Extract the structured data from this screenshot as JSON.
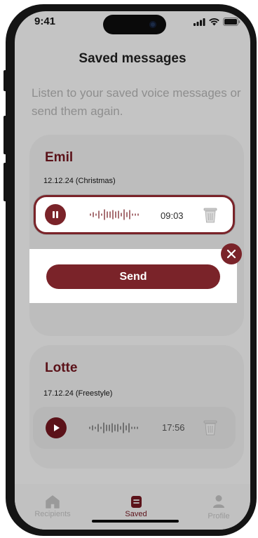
{
  "status_bar": {
    "time": "9:41"
  },
  "header": {
    "title": "Saved messages"
  },
  "intro_text": "Listen to your saved voice messages or send them again.",
  "messages": [
    {
      "name": "Emil",
      "date": "12.12.24 (Christmas)",
      "duration": "09:03",
      "state": "playing"
    },
    {
      "name": "Lotte",
      "date": "17.12.24 (Freestyle)",
      "duration": "17:56",
      "state": "paused"
    }
  ],
  "send_panel": {
    "send_label": "Send"
  },
  "tabs": [
    {
      "label": "Recipients",
      "icon": "home-icon",
      "active": false
    },
    {
      "label": "Saved",
      "icon": "saved-icon",
      "active": true
    },
    {
      "label": "Profile",
      "icon": "profile-icon",
      "active": false
    }
  ],
  "colors": {
    "accent": "#7a2329",
    "accent_dark": "#5b1219",
    "overlay_background": "#c4c4c4"
  }
}
